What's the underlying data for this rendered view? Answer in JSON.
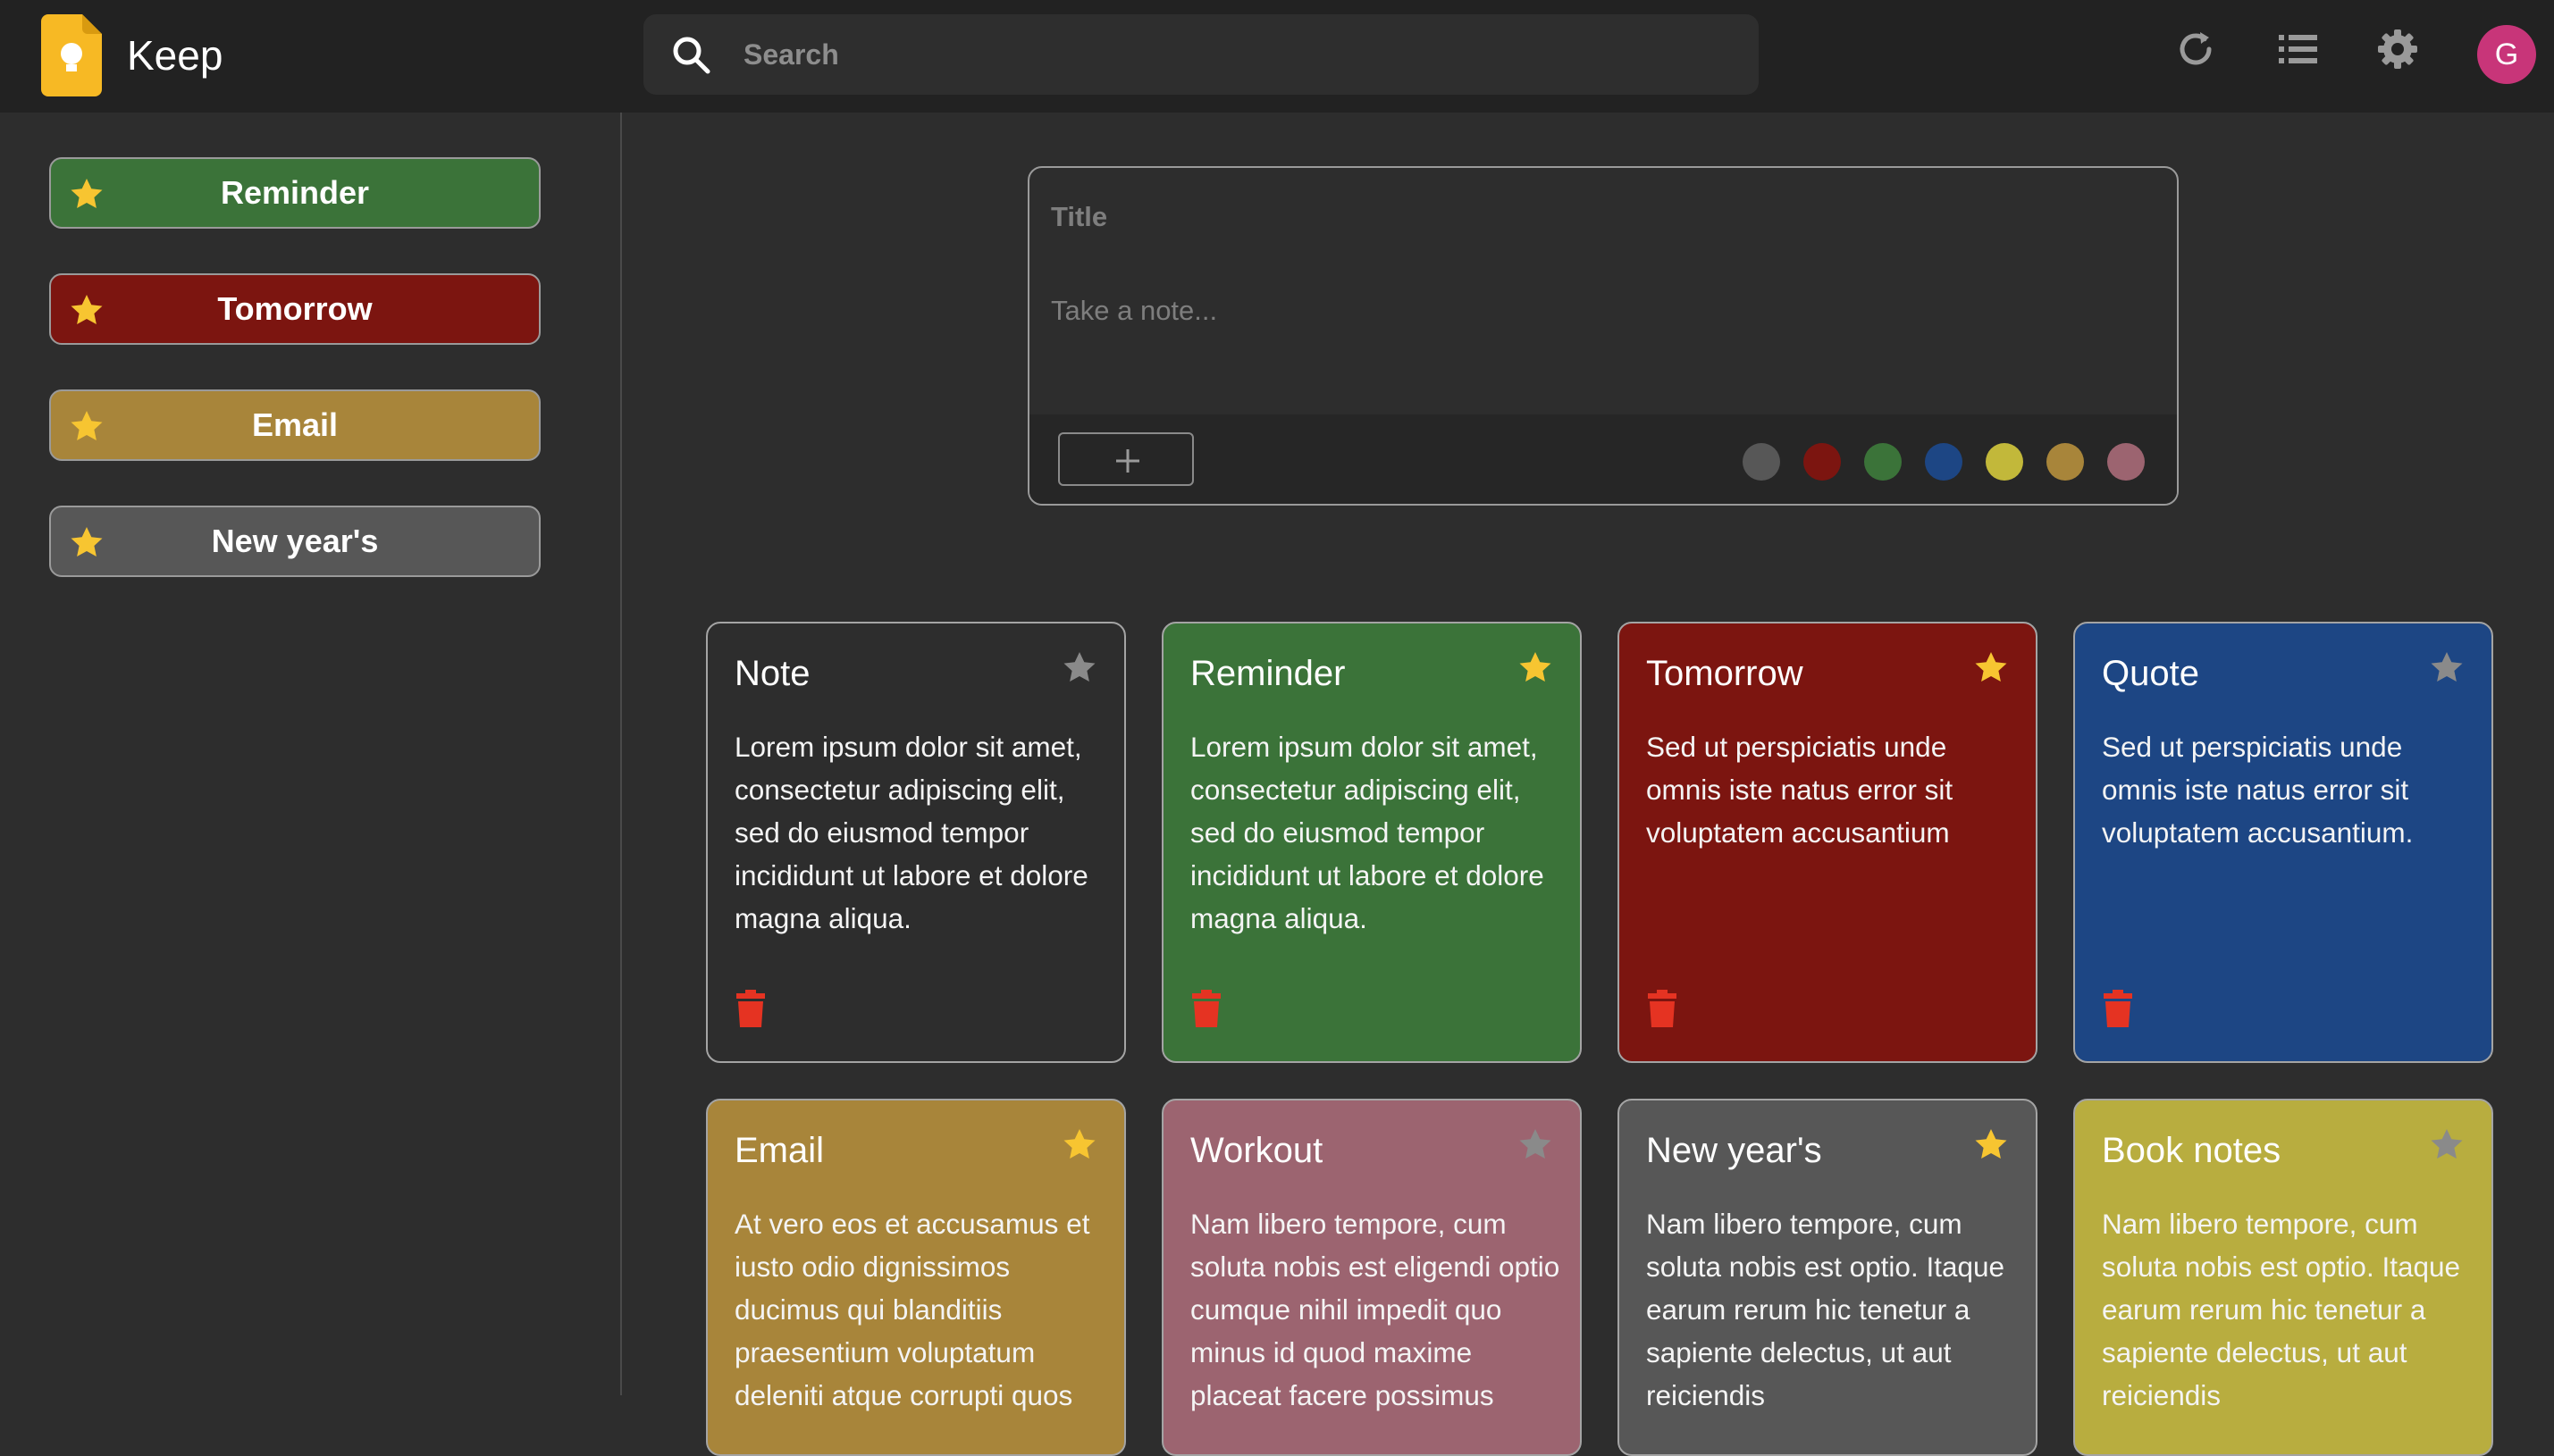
{
  "header": {
    "app_name": "Keep",
    "search_placeholder": "Search",
    "avatar_letter": "G",
    "icons": [
      "keep-logo-icon",
      "search-icon",
      "refresh-icon",
      "list-view-icon",
      "gear-icon"
    ]
  },
  "sidebar": {
    "pinned": [
      {
        "label": "Reminder",
        "color": "#3b7339"
      },
      {
        "label": "Tomorrow",
        "color": "#7c1510"
      },
      {
        "label": "Email",
        "color": "#a8853a"
      },
      {
        "label": "New year's",
        "color": "#575757"
      }
    ]
  },
  "composer": {
    "title_placeholder": "Title",
    "body_placeholder": "Take a note...",
    "add_symbol": "+",
    "colors": [
      "#575757",
      "#7c1510",
      "#3b7339",
      "#1d4684",
      "#c2b83a",
      "#a8853a",
      "#9c6470"
    ]
  },
  "notes": [
    {
      "title": "Note",
      "starred": false,
      "color": "#2d2d2d",
      "body": "Lorem ipsum dolor sit amet, consectetur adipiscing elit, sed do eiusmod tempor incididunt ut labore et dolore magna aliqua."
    },
    {
      "title": "Reminder",
      "starred": true,
      "color": "#3b7339",
      "body": "Lorem ipsum dolor sit amet, consectetur adipiscing elit, sed do eiusmod tempor incididunt ut labore et dolore magna aliqua."
    },
    {
      "title": "Tomorrow",
      "starred": true,
      "color": "#7c1510",
      "body": "Sed ut perspiciatis unde omnis iste natus error sit voluptatem accusantium"
    },
    {
      "title": "Quote",
      "starred": false,
      "color": "#1d4684",
      "body": "Sed ut perspiciatis unde omnis iste natus error sit voluptatem accusantium."
    },
    {
      "title": "Email",
      "starred": true,
      "color": "#a8853a",
      "body": "At vero eos et accusamus et iusto odio dignissimos ducimus qui blanditiis praesentium voluptatum deleniti atque corrupti quos"
    },
    {
      "title": "Workout",
      "starred": false,
      "color": "#9c6470",
      "body": "Nam libero tempore, cum soluta nobis est eligendi optio cumque nihil impedit quo minus id quod maxime placeat facere possimus"
    },
    {
      "title": "New year's",
      "starred": true,
      "color": "#575757",
      "body": "Nam libero tempore, cum soluta nobis est optio. Itaque earum rerum hic tenetur a sapiente delectus, ut aut reiciendis"
    },
    {
      "title": "Book notes",
      "starred": false,
      "color": "#b8ad3f",
      "body": "Nam libero tempore, cum soluta nobis est optio. Itaque earum rerum hic tenetur a sapiente delectus, ut aut reiciendis"
    }
  ],
  "theme": {
    "star_on": "#f7c531",
    "star_off": "#8a8a8a",
    "delete": "#e53322"
  }
}
